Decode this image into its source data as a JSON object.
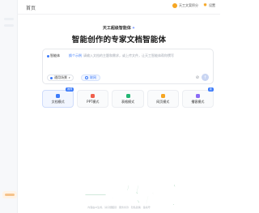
{
  "topbar": {
    "home_label": "首页",
    "tools": [
      {
        "label": "天工文案积分",
        "icon": "coin-icon"
      },
      {
        "label": "设置",
        "icon": "gear-icon"
      }
    ]
  },
  "hero": {
    "brand": "天工超级智能体",
    "title": "智能创作的专家文档智能体"
  },
  "composer": {
    "mode_label": "智能体",
    "sample_label": "换个示例",
    "placeholder": "请输入文档的主题和需求，或上传文件，让天工智能体帮你撰写",
    "select_label": "通用场景",
    "search_label": "联网",
    "attach_icon": "paperclip-icon",
    "send_icon": "send-icon"
  },
  "modes": [
    {
      "label": "文档模式",
      "badge": "推荐",
      "icon_color": "#3c7bfa"
    },
    {
      "label": "PPT模式",
      "badge": "",
      "icon_color": "#f0604d"
    },
    {
      "label": "表格模式",
      "badge": "",
      "icon_color": "#22b573"
    },
    {
      "label": "网页模式",
      "badge": "",
      "icon_color": "#f6a623"
    },
    {
      "label": "播客模式",
      "badge": "新",
      "icon_color": "#8b6cf6"
    }
  ],
  "watermark": {
    "text": "一号导航"
  },
  "footer": {
    "text": "内容由AI生成，请仔细甄别 · 服务条款 · 隐私政策 · 备案号"
  },
  "colors": {
    "accent": "#3c7bfa",
    "watermark": "#2e9b5b"
  }
}
